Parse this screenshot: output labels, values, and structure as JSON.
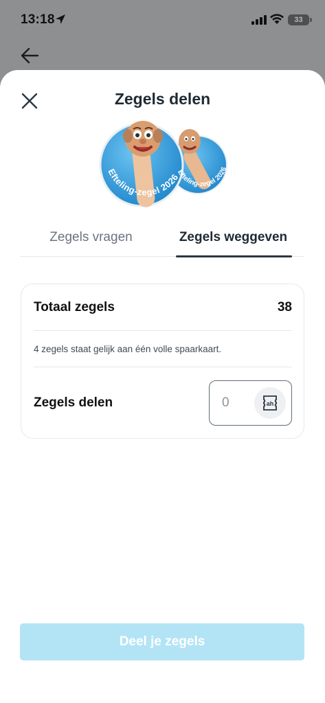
{
  "status_bar": {
    "time": "13:18",
    "battery": "33",
    "icons": [
      "location-arrow-icon",
      "cellular-signal-icon",
      "wifi-icon",
      "battery-icon"
    ]
  },
  "nav": {
    "back_icon": "arrow-left-icon"
  },
  "sheet": {
    "close_icon": "close-icon",
    "title": "Zegels delen",
    "hero_stamp_text": "Efteling-zegel 2026",
    "tabs": [
      {
        "label": "Zegels vragen",
        "active": false
      },
      {
        "label": "Zegels weggeven",
        "active": true
      }
    ],
    "card": {
      "total_label": "Totaal zegels",
      "total_value": "38",
      "info_text": "4 zegels staat gelijk aan één volle spaarkaart.",
      "share_label": "Zegels delen",
      "share_value": "0",
      "share_icon": "stamp-icon"
    },
    "cta_label": "Deel je zegels"
  },
  "colors": {
    "overlay": "#8e8f91",
    "accent_light_blue": "#b3e4f6",
    "title": "#1f2a33",
    "stamp_blue": "#2f9ad8"
  }
}
